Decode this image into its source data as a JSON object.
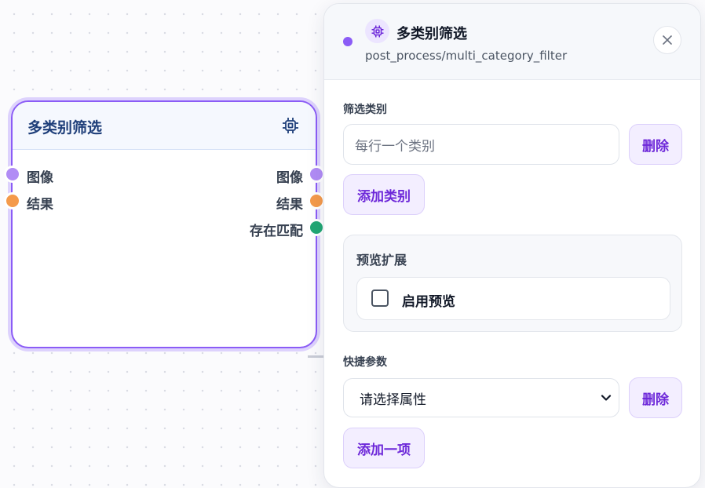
{
  "node": {
    "title": "多类别筛选",
    "icon": "chip-icon",
    "inputs": [
      {
        "label": "图像",
        "color": "#b18cf5"
      },
      {
        "label": "结果",
        "color": "#f49a4b"
      }
    ],
    "outputs": [
      {
        "label": "图像",
        "color": "#b18cf5"
      },
      {
        "label": "结果",
        "color": "#f49a4b"
      },
      {
        "label": "存在匹配",
        "color": "#22a774"
      }
    ]
  },
  "panel": {
    "title": "多类别筛选",
    "subtitle": "post_process/multi_category_filter",
    "status_color": "#8b5cf6",
    "close_icon": "close-icon",
    "filter_section": {
      "label": "筛选类别",
      "input_placeholder": "每行一个类别",
      "delete_label": "删除",
      "add_label": "添加类别"
    },
    "preview_section": {
      "title": "预览扩展",
      "checkbox_label": "启用预览",
      "checked": false
    },
    "quick_params": {
      "label": "快捷参数",
      "select_value": "请选择属性",
      "delete_label": "删除",
      "add_label": "添加一项"
    }
  },
  "colors": {
    "accent": "#8b5cf6",
    "node_title": "#1f3f7a",
    "button_text": "#6d28d9"
  }
}
